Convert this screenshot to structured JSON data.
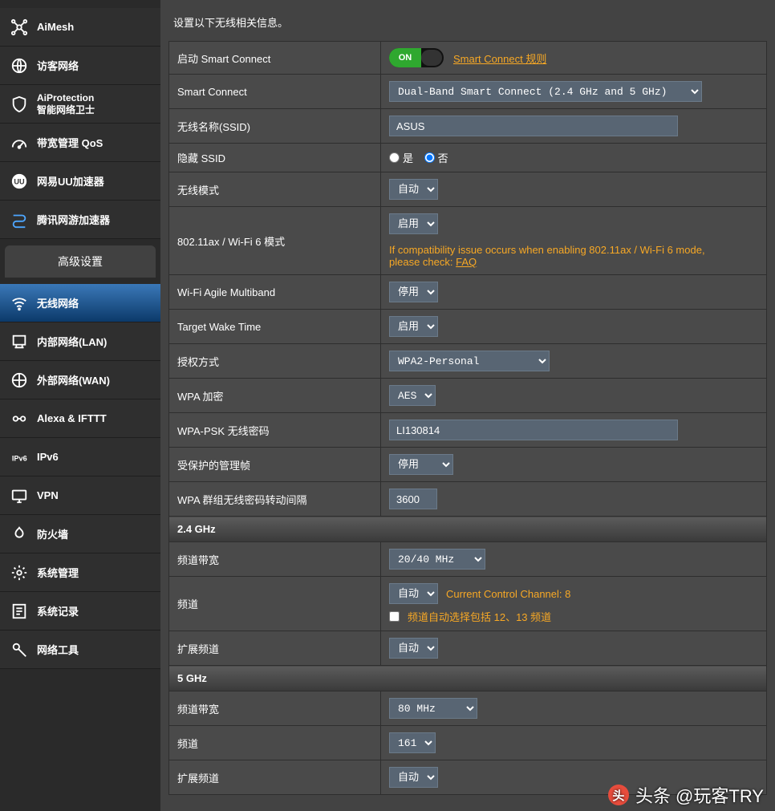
{
  "sidebar": {
    "top": [
      {
        "label": "AiMesh",
        "name": "aimesh"
      },
      {
        "label": "访客网络",
        "name": "guest-network"
      },
      {
        "label_line1": "AiProtection",
        "label_line2": "智能网络卫士",
        "name": "aiprotection",
        "two_line": true
      },
      {
        "label": "带宽管理 QoS",
        "name": "qos"
      },
      {
        "label": "网易UU加速器",
        "name": "uu-booster"
      },
      {
        "label": "腾讯网游加速器",
        "name": "tencent-booster"
      }
    ],
    "section_title": "高级设置",
    "advanced": [
      {
        "label": "无线网络",
        "name": "wireless",
        "active": true
      },
      {
        "label": "内部网络(LAN)",
        "name": "lan"
      },
      {
        "label": "外部网络(WAN)",
        "name": "wan"
      },
      {
        "label": "Alexa & IFTTT",
        "name": "alexa-ifttt"
      },
      {
        "label": "IPv6",
        "name": "ipv6"
      },
      {
        "label": "VPN",
        "name": "vpn"
      },
      {
        "label": "防火墙",
        "name": "firewall"
      },
      {
        "label": "系统管理",
        "name": "administration"
      },
      {
        "label": "系统记录",
        "name": "system-log"
      },
      {
        "label": "网络工具",
        "name": "network-tools"
      }
    ]
  },
  "page": {
    "desc": "设置以下无线相关信息。",
    "rows": {
      "smart_connect_enable": {
        "label": "启动 Smart Connect",
        "toggle_on": "ON",
        "rule_link": "Smart Connect 规则"
      },
      "smart_connect": {
        "label": "Smart Connect",
        "value": "Dual-Band Smart Connect (2.4 GHz and 5 GHz)"
      },
      "ssid": {
        "label": "无线名称(SSID)",
        "value": "ASUS"
      },
      "hide_ssid": {
        "label": "隐藏 SSID",
        "yes": "是",
        "no": "否"
      },
      "wl_mode": {
        "label": "无线模式",
        "value": "自动"
      },
      "ax_mode": {
        "label": "802.11ax / Wi-Fi 6 模式",
        "value": "启用",
        "note1": "If compatibility issue occurs when enabling 802.11ax / Wi-Fi 6 mode, please check: ",
        "faq": "FAQ"
      },
      "agile": {
        "label": "Wi-Fi Agile Multiband",
        "value": "停用"
      },
      "twt": {
        "label": "Target Wake Time",
        "value": "启用"
      },
      "auth": {
        "label": "授权方式",
        "value": "WPA2-Personal"
      },
      "wpa_enc": {
        "label": "WPA 加密",
        "value": "AES"
      },
      "wpa_psk": {
        "label": "WPA-PSK 无线密码",
        "value": "LI130814"
      },
      "pmf": {
        "label": "受保护的管理帧",
        "value": "停用"
      },
      "gtk": {
        "label": "WPA 群组无线密码转动间隔",
        "value": "3600"
      }
    },
    "band24": {
      "header": "2.4 GHz",
      "bw": {
        "label": "频道带宽",
        "value": "20/40 MHz"
      },
      "ch": {
        "label": "频道",
        "value": "自动",
        "cc_label": "Current Control Channel: 8",
        "auto_note": "频道自动选择包括 12、13 频道"
      },
      "ext": {
        "label": "扩展频道",
        "value": "自动"
      }
    },
    "band5": {
      "header": "5 GHz",
      "bw": {
        "label": "频道带宽",
        "value": "80 MHz"
      },
      "ch": {
        "label": "频道",
        "value": "161"
      },
      "ext": {
        "label": "扩展频道",
        "value": "自动"
      }
    }
  },
  "watermark": "头条 @玩客TRY"
}
